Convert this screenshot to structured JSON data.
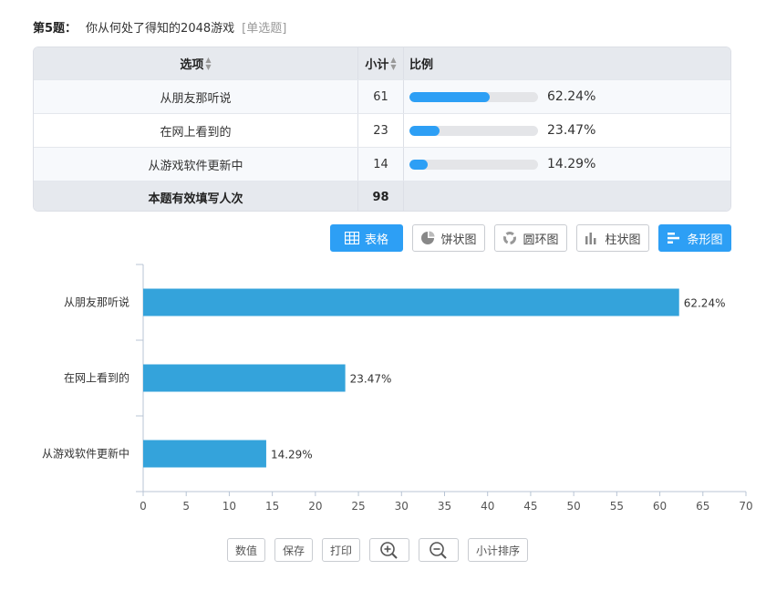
{
  "question": {
    "number": "第5题：",
    "text": "你从何处了得知的2048游戏",
    "type": "[单选题]"
  },
  "table": {
    "headers": {
      "option": "选项",
      "count": "小计",
      "ratio": "比例"
    },
    "rows": [
      {
        "option": "从朋友那听说",
        "count": "61",
        "percent": "62.24%",
        "fraction": 0.6224
      },
      {
        "option": "在网上看到的",
        "count": "23",
        "percent": "23.47%",
        "fraction": 0.2347
      },
      {
        "option": "从游戏软件更新中",
        "count": "14",
        "percent": "14.29%",
        "fraction": 0.1429
      }
    ],
    "footer": {
      "label": "本题有效填写人次",
      "total": "98"
    }
  },
  "view_buttons": [
    {
      "label": "表格",
      "icon": "table-icon",
      "active": true
    },
    {
      "label": "饼状图",
      "icon": "pie-chart-icon",
      "active": false
    },
    {
      "label": "圆环图",
      "icon": "donut-chart-icon",
      "active": false
    },
    {
      "label": "柱状图",
      "icon": "column-chart-icon",
      "active": false
    },
    {
      "label": "条形图",
      "icon": "bar-chart-icon",
      "active": true
    }
  ],
  "chart_data": {
    "type": "bar",
    "orientation": "horizontal",
    "categories": [
      "从朋友那听说",
      "在网上看到的",
      "从游戏软件更新中"
    ],
    "values": [
      62.24,
      23.47,
      14.29
    ],
    "value_labels": [
      "62.24%",
      "23.47%",
      "14.29%"
    ],
    "xlim": [
      0,
      70
    ],
    "xticks": [
      0,
      5,
      10,
      15,
      20,
      25,
      30,
      35,
      40,
      45,
      50,
      55,
      60,
      65,
      70
    ],
    "grid": false,
    "bar_color": "#34a3db"
  },
  "toolbar": {
    "value_label": "数值",
    "save_label": "保存",
    "print_label": "打印",
    "zoom_in_icon": "zoom-in-icon",
    "zoom_out_icon": "zoom-out-icon",
    "sort_label": "小计排序"
  },
  "colors": {
    "accent": "#2d9ff5",
    "progress_track": "#e4e5e8",
    "header_bg": "#e6e9ee"
  }
}
